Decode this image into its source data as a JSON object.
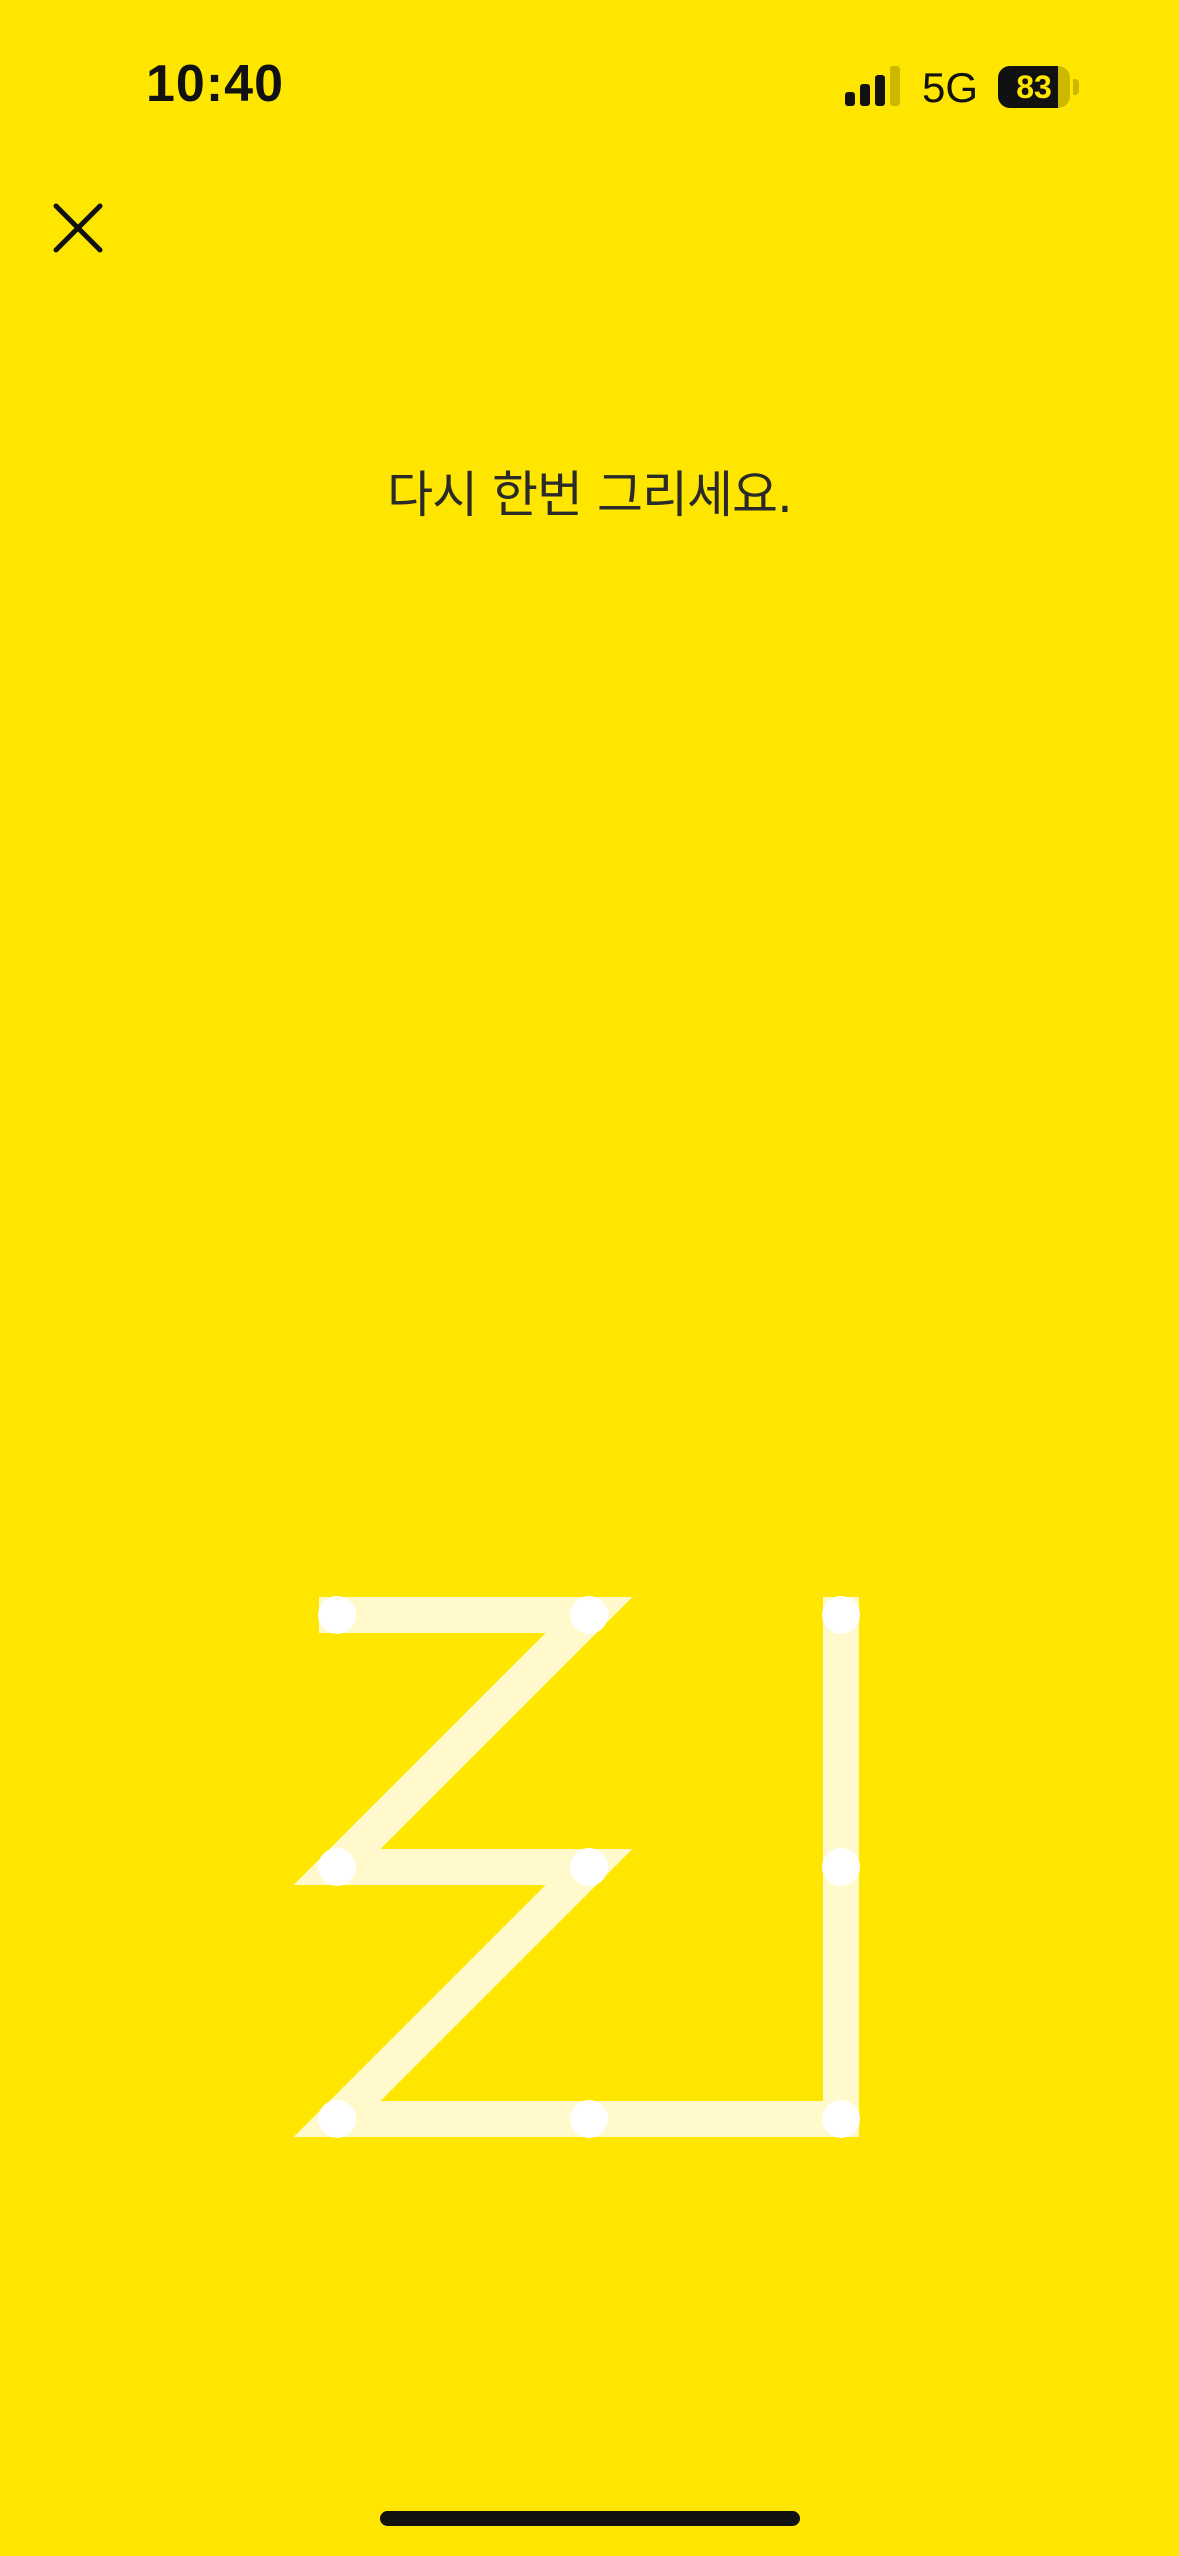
{
  "status_bar": {
    "time": "10:40",
    "network": "5G",
    "battery_level": "83",
    "battery_fraction": 0.83,
    "signal_icon": "cellular-signal-icon",
    "signal_bars_active": 3,
    "signal_bars_total": 4
  },
  "header": {
    "close_icon": "close-icon"
  },
  "instruction": {
    "text": "다시 한번 그리세요."
  },
  "pattern": {
    "grid_size": 3,
    "drawn_sequence": [
      0,
      1,
      3,
      4,
      6,
      7,
      8,
      5,
      2
    ]
  },
  "colors": {
    "background": "#FFE600",
    "pattern_line": "#FFF9CC",
    "pattern_dot": "#FFFFFF",
    "text": "#2a2a2a"
  }
}
